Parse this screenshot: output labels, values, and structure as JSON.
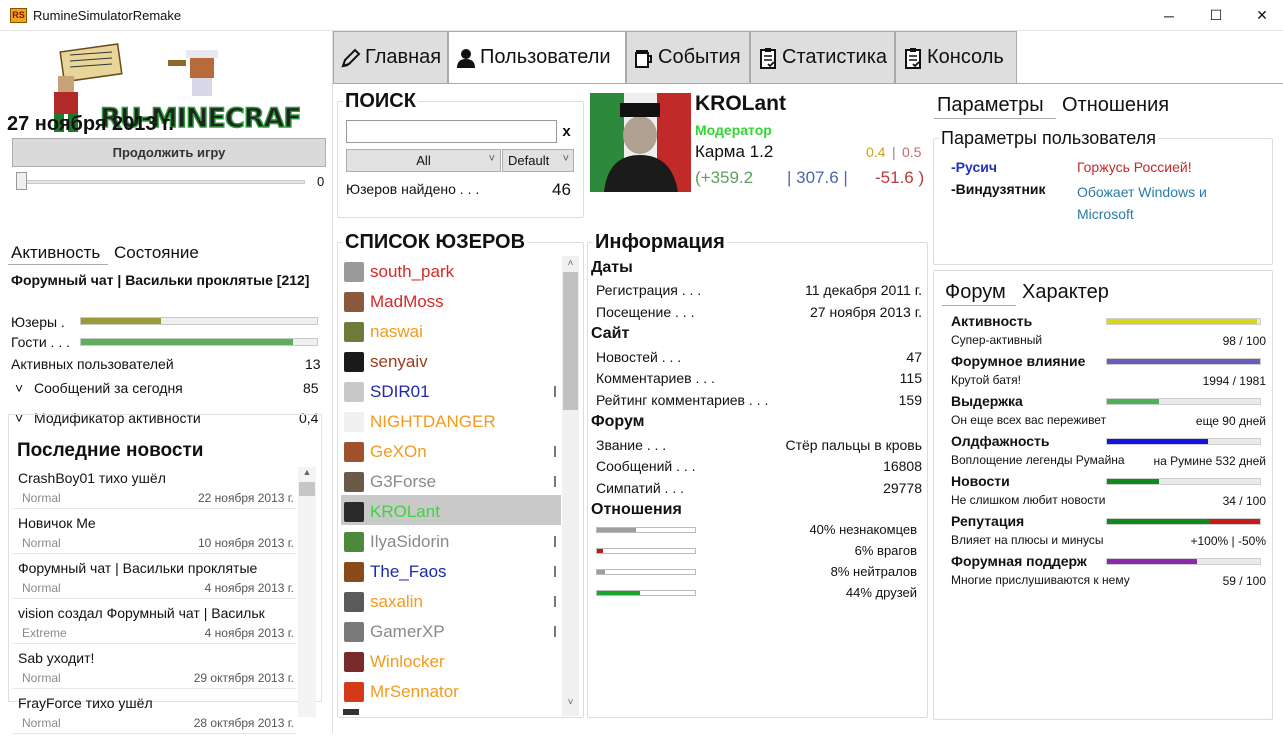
{
  "window": {
    "title": "RumineSimulatorRemake",
    "app_icon_text": "RS",
    "minimize": "─",
    "maximize": "☐",
    "close": "✕"
  },
  "sidebar": {
    "logo_text": "RU-MINECRAFT.RU",
    "date": "27 ноября 2013 г.",
    "continue_button": "Продолжить игру",
    "speed_value": "0",
    "tabs": [
      "Активность",
      "Состояние"
    ],
    "chat_title": "Форумный чат | Васильки проклятые [212]",
    "users_label": "Юзеры .",
    "guests_label": "Гости . . .",
    "users_fill": 0.34,
    "guests_fill": 0.9,
    "stats": [
      {
        "label": "Активных пользователей",
        "value": "13"
      },
      {
        "label": "Сообщений за сегодня",
        "value": "85"
      },
      {
        "label": "Модификатор активности",
        "value": "0,4"
      }
    ],
    "news_title": "Последние новости",
    "news": [
      {
        "title": "CrashBoy01 тихо ушёл",
        "tag": "Normal",
        "date": "22 ноября 2013 г."
      },
      {
        "title": "Новичок Me",
        "tag": "Normal",
        "date": "10 ноября 2013 г."
      },
      {
        "title": "Форумный чат | Васильки проклятые",
        "tag": "Normal",
        "date": "4 ноября 2013 г."
      },
      {
        "title": "vision создал Форумный чат | Васильк",
        "tag": "Extreme",
        "date": "4 ноября 2013 г."
      },
      {
        "title": "Sab уходит!",
        "tag": "Normal",
        "date": "29 октября 2013 г."
      },
      {
        "title": "FrayForce тихо ушёл",
        "tag": "Normal",
        "date": "28 октября 2013 г."
      }
    ]
  },
  "main_tabs": [
    {
      "label": "Главная",
      "icon": "pencil-icon"
    },
    {
      "label": "Пользователи",
      "icon": "user-icon"
    },
    {
      "label": "События",
      "icon": "beer-icon"
    },
    {
      "label": "Статистика",
      "icon": "clipboard-icon"
    },
    {
      "label": "Консоль",
      "icon": "clipboard-icon"
    }
  ],
  "search": {
    "title": "ПОИСК",
    "value": "",
    "clear": "x",
    "filter1": "All",
    "filter2": "Default",
    "found_label": "Юзеров найдено . . .",
    "found_count": "46"
  },
  "user_list": {
    "title": "СПИСОК ЮЗЕРОВ",
    "items": [
      {
        "name": "south_park",
        "color": "#d42a2a",
        "avatar": "#9a9a9a",
        "pip": false
      },
      {
        "name": "MadMoss",
        "color": "#d42a2a",
        "avatar": "#8b5a3c",
        "pip": false
      },
      {
        "name": "naswai",
        "color": "#f29a1c",
        "avatar": "#6d7b3a",
        "pip": false
      },
      {
        "name": "senyaiv",
        "color": "#9a3c1e",
        "avatar": "#1a1a1a",
        "pip": false
      },
      {
        "name": "SDIR01",
        "color": "#1c2aa8",
        "avatar": "#c8c8c8",
        "pip": true
      },
      {
        "name": "NIGHTDANGER",
        "color": "#f29a1c",
        "avatar": "#f0f0f0",
        "pip": false
      },
      {
        "name": "GeXOn",
        "color": "#f29a1c",
        "avatar": "#a0522d",
        "pip": true
      },
      {
        "name": "G3Forse",
        "color": "#8a8a8a",
        "avatar": "#6b5a4a",
        "pip": true
      },
      {
        "name": "KROLant",
        "color": "#3fd43f",
        "avatar": "#2a2a2a",
        "pip": false
      },
      {
        "name": "IlyaSidorin",
        "color": "#8a8a8a",
        "avatar": "#4a8a3a",
        "pip": true
      },
      {
        "name": "The_Faos",
        "color": "#1c2aa8",
        "avatar": "#8a4a1a",
        "pip": true
      },
      {
        "name": "saxalin",
        "color": "#f29a1c",
        "avatar": "#5a5a5a",
        "pip": true
      },
      {
        "name": "GamerXP",
        "color": "#8a8a8a",
        "avatar": "#7a7a7a",
        "pip": true
      },
      {
        "name": "Winlocker",
        "color": "#f29a1c",
        "avatar": "#7a2a2a",
        "pip": false
      },
      {
        "name": "MrSennator",
        "color": "#f29a1c",
        "avatar": "#d43a1a",
        "pip": false
      }
    ]
  },
  "profile": {
    "name": "KROLant",
    "role": "Модератор",
    "karma_label": "Карма 1.2",
    "karma_ratio_a": "0.4",
    "karma_ratio_sep": "|",
    "karma_ratio_b": "0.5",
    "plus": "(+359.2",
    "total": "| 307.6 |",
    "minus": "-51.6 )"
  },
  "info": {
    "title": "Информация",
    "dates_head": "Даты",
    "reg_label": "Регистрация . . .",
    "reg_value": "11 декабря 2011 г.",
    "visit_label": "Посещение . . .",
    "visit_value": "27 ноября 2013 г.",
    "site_head": "Сайт",
    "news_label": "Новостей . . .",
    "news_value": "47",
    "comments_label": "Комментариев . . .",
    "comments_value": "115",
    "rating_label": "Рейтинг комментариев . . .",
    "rating_value": "159",
    "forum_head": "Форум",
    "rank_label": "Звание . . .",
    "rank_value": "Стёр пальцы в кровь",
    "posts_label": "Сообщений . . .",
    "posts_value": "16808",
    "likes_label": "Симпатий . . .",
    "likes_value": "29778",
    "rel_head": "Отношения",
    "relations": [
      {
        "label": "40% незнакомцев",
        "fill": 0.4,
        "color": "#9e9e9e"
      },
      {
        "label": "6% врагов",
        "fill": 0.06,
        "color": "#c01b1b"
      },
      {
        "label": "8% нейтралов",
        "fill": 0.08,
        "color": "#9e9e9e"
      },
      {
        "label": "44% друзей",
        "fill": 0.44,
        "color": "#17a82a"
      }
    ]
  },
  "params": {
    "tabs": [
      "Параметры",
      "Отношения"
    ],
    "title": "Параметры пользователя",
    "items": [
      {
        "name": "-Русич",
        "name_color": "#2233bb",
        "desc": "Горжусь Россией!",
        "desc_color": "#c42a2a"
      },
      {
        "name": "-Виндузятник",
        "name_color": "#111111",
        "desc": "Обожает Windows и Microsoft",
        "desc_color": "#2a7aa8"
      }
    ]
  },
  "character": {
    "tabs": [
      "Форум",
      "Характер"
    ],
    "rows": [
      {
        "name": "Активность",
        "desc": "Супер-активный",
        "value": "98 / 100",
        "fill": 0.98,
        "color": "#d6d61e"
      },
      {
        "name": "Форумное влияние",
        "desc": "Крутой батя!",
        "value": "1994 / 1981",
        "fill": 1.0,
        "color": "#6a5cb8"
      },
      {
        "name": "Выдержка",
        "desc": "Он еще всех вас переживет",
        "value": "еще 90 дней",
        "fill": 0.34,
        "color": "#4fae5a"
      },
      {
        "name": "Олдфажность",
        "desc": "Воплощение легенды Румайна",
        "value": "на Румине 532 дней",
        "fill": 0.66,
        "color": "#1414e0"
      },
      {
        "name": "Новости",
        "desc": "Не слишком любит новости",
        "value": "34 / 100",
        "fill": 0.34,
        "color": "#108a1c"
      },
      {
        "name": "Репутация",
        "desc": "Влияет на плюсы и минусы",
        "value": "+100% | -50%",
        "fill": 0.67,
        "color": "#108a1c",
        "fill2": 0.33,
        "color2": "#c41c1c"
      },
      {
        "name": "Форумная поддерж",
        "desc": "Многие прислушиваются к нему",
        "value": "59 / 100",
        "fill": 0.59,
        "color": "#8a2ab0"
      }
    ]
  }
}
